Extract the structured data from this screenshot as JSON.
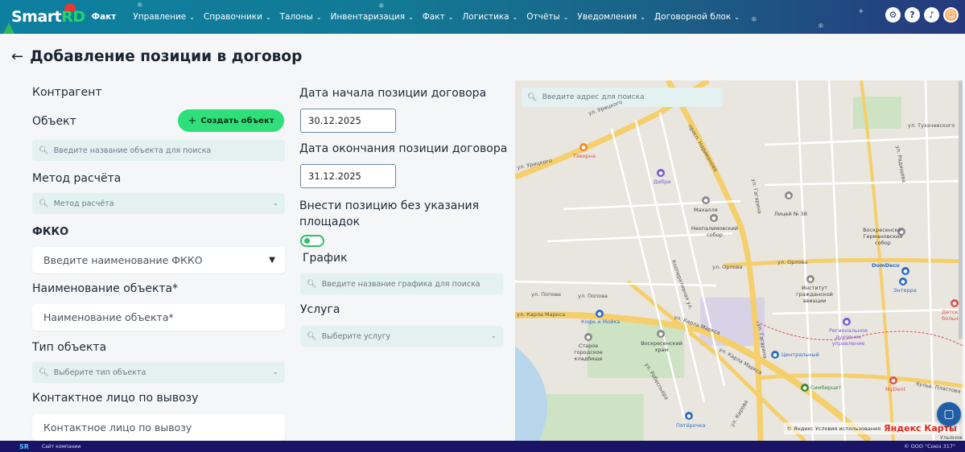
{
  "app": {
    "logo_main": "Smart",
    "logo_accent": "RD",
    "logo_tag": "Факт"
  },
  "nav": {
    "items": [
      {
        "label": "Управление",
        "has_dropdown": true
      },
      {
        "label": "Справочники",
        "has_dropdown": true
      },
      {
        "label": "Талоны",
        "has_dropdown": true
      },
      {
        "label": "Инвентаризация",
        "has_dropdown": true
      },
      {
        "label": "Факт",
        "has_dropdown": true
      },
      {
        "label": "Логистика",
        "has_dropdown": true
      },
      {
        "label": "Отчёты",
        "has_dropdown": true
      },
      {
        "label": "Уведомления",
        "has_dropdown": true
      },
      {
        "label": "Договорной блок",
        "has_dropdown": true
      }
    ],
    "icons": [
      "settings-icon",
      "help-icon",
      "bell-icon",
      "avatar"
    ]
  },
  "page": {
    "title": "Добавление позиции в договор"
  },
  "form": {
    "contractor_label": "Контрагент",
    "object_label": "Объект",
    "create_object_button": "Создать объект",
    "object_search_placeholder": "Введите название объекта для поиска",
    "calc_method_label": "Метод расчёта",
    "calc_method_placeholder": "Метод расчёта",
    "fkko_label": "ФККО",
    "fkko_placeholder": "Введите наименование ФККО",
    "object_name_label": "Наименование объекта*",
    "object_name_placeholder": "Наименование объекта*",
    "object_type_label": "Тип объекта",
    "object_type_placeholder": "Выберите тип объекта",
    "contact_label": "Контактное лицо по вывозу",
    "contact_placeholder": "Контактное лицо по вывозу",
    "start_date_label": "Дата начала позиции договора",
    "start_date_value": "30.12.2025",
    "end_date_label": "Дата окончания позиции договора",
    "end_date_value": "31.12.2025",
    "no_sites_label": "Внести позицию без указания площадок",
    "no_sites_enabled": false,
    "schedule_label": "График",
    "schedule_placeholder": "Введите название графика для поиска",
    "service_label": "Услуга",
    "service_placeholder": "Выберите услугу"
  },
  "map": {
    "search_placeholder": "Введите адрес для поиска",
    "streets": [
      "ул. Урицкого",
      "ул. Урицкого",
      "ул. Карла Маркса",
      "ул. Карла Маркса",
      "ул. Карла Маркса",
      "ул. Гагарина",
      "ул. Гагарина",
      "ул. Орлова",
      "ул. Орлова",
      "ул. Попова",
      "ул. Попова",
      "ул. Робеспьера",
      "ул. Кирова",
      "ул. Тухачевского",
      "ул. Радищева",
      "Кооперативная ул.",
      "просп. Нариманова",
      "бульв. Пластова",
      "Ульяновск"
    ],
    "pois": [
      {
        "name": "Таверна",
        "color": "#f08a24"
      },
      {
        "name": "Дебри",
        "color": "#7b5cd6"
      },
      {
        "name": "Махалля",
        "color": "#8a8a8a"
      },
      {
        "name": "Неопалимовский собор",
        "color": "#8a8a8a"
      },
      {
        "name": "Лицей № 38",
        "color": "#8a8a8a"
      },
      {
        "name": "Воскресенско-Германовский собор",
        "color": "#8a8a8a"
      },
      {
        "name": "DomDeco",
        "color": "#2b6cc4"
      },
      {
        "name": "Энтерра",
        "color": "#2b6cc4"
      },
      {
        "name": "Институт гражданской авиации",
        "color": "#8a8a8a"
      },
      {
        "name": "Кофе и Мойка",
        "color": "#2b6cc4"
      },
      {
        "name": "Старое городское кладбище",
        "color": "#8a8a8a"
      },
      {
        "name": "Воскресенский храм",
        "color": "#8a8a8a"
      },
      {
        "name": "Центральный",
        "color": "#2b6cc4"
      },
      {
        "name": "Региональное духовное управление",
        "color": "#7b5cd6"
      },
      {
        "name": "Симбирцит",
        "color": "#3a8a3a"
      },
      {
        "name": "MyDent",
        "color": "#d9534f"
      },
      {
        "name": "Детская больница",
        "color": "#d9534f"
      },
      {
        "name": "Пятёрочка",
        "color": "#2b6cc4"
      }
    ],
    "credit": "© Яндекс Условия использования",
    "brand": "Яндекс Карты"
  },
  "footer": {
    "logo": "SR",
    "site_link": "Сайт компании",
    "copyright": "© ООО \"Союз 317\""
  },
  "colors": {
    "accent_green": "#2fe07a",
    "footer_bg": "#1a1466",
    "field_bg": "#e3f1f1"
  }
}
